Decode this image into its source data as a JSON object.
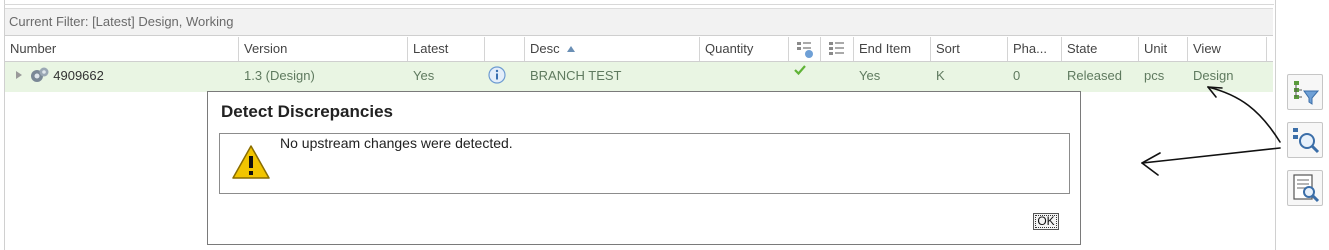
{
  "filter": {
    "text": "Current Filter: [Latest] Design, Working"
  },
  "table": {
    "columns": [
      "Number",
      "Version",
      "Latest",
      "",
      "Desc",
      "Quantity",
      "",
      "",
      "End Item",
      "Sort",
      "Pha...",
      "State",
      "Unit",
      "View"
    ],
    "sort_indicator": "ascending",
    "row": {
      "number": "4909662",
      "version": "1.3 (Design)",
      "latest": "Yes",
      "desc": "BRANCH TEST",
      "quantity": "",
      "end_item": "Yes",
      "sort": "K",
      "phase": "0",
      "state": "Released",
      "unit": "pcs",
      "view": "Design"
    }
  },
  "dialog": {
    "title": "Detect Discrepancies",
    "message": "No upstream changes were detected.",
    "ok_label": "OK"
  },
  "icons": {
    "row_expand": "triangle-right-icon",
    "part": "part-gears-icon",
    "info": "info-icon",
    "check": "check-icon",
    "warning": "warning-icon",
    "side_buttons": [
      "structure-filter-icon",
      "detect-discrepancies-icon",
      "report-search-icon"
    ]
  },
  "colors": {
    "row_bg": "#e9f5e3",
    "check": "#5fb336",
    "warning": "#f2c500"
  }
}
